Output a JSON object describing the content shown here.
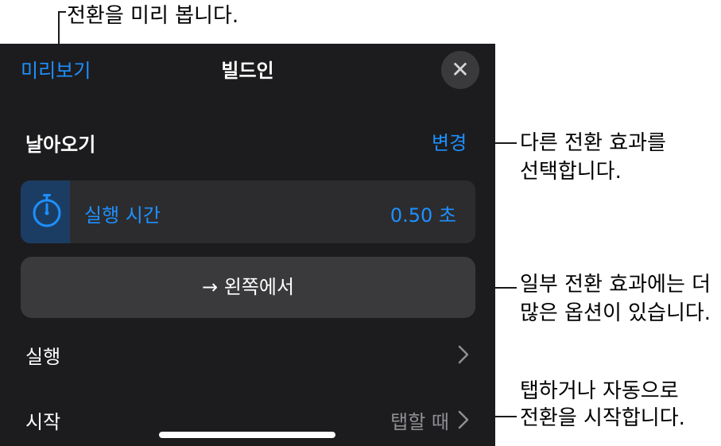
{
  "callouts": {
    "preview": "전환을 미리 봅니다.",
    "change_line1": "다른 전환 효과를",
    "change_line2": "선택합니다.",
    "options_line1": "일부 전환 효과에는 더",
    "options_line2": "많은 옵션이 있습니다.",
    "start_line1": "탭하거나 자동으로",
    "start_line2": "전환을 시작합니다."
  },
  "panel": {
    "preview_label": "미리보기",
    "title": "빌드인",
    "close_icon": "✕",
    "effect_name": "날아오기",
    "change_label": "변경",
    "duration": {
      "icon": "stopwatch-icon",
      "label": "실행 시간",
      "value": "0.50 초"
    },
    "direction": {
      "arrow": "→",
      "label": "왼쪽에서"
    },
    "delivery": {
      "label": "실행"
    },
    "start": {
      "label": "시작",
      "value": "탭할 때"
    }
  },
  "colors": {
    "accent": "#1e90ff",
    "panel_bg": "#1c1c1e",
    "row_bg": "#2c2c2e",
    "button_bg": "#3a3a3c",
    "secondary_text": "#8e8e93"
  }
}
